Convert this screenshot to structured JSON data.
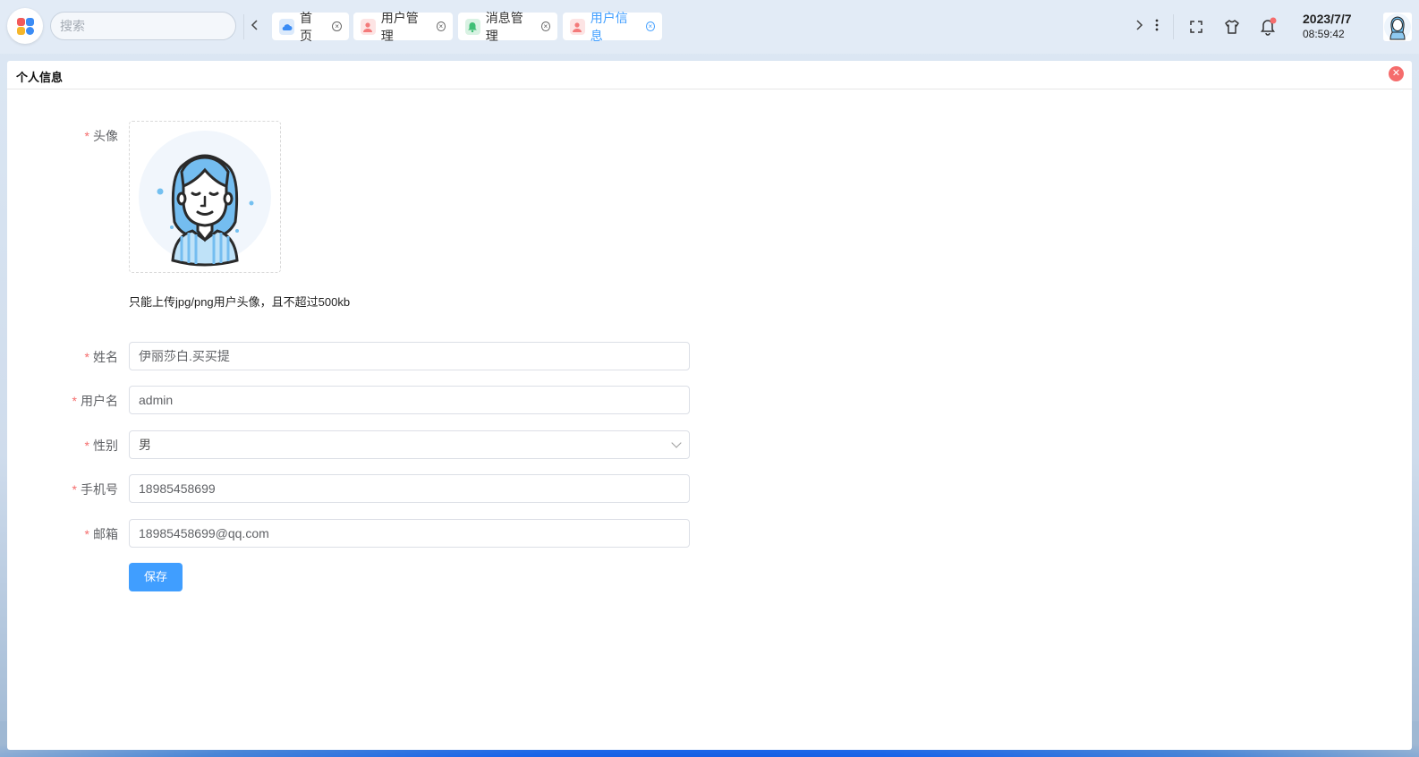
{
  "search": {
    "placeholder": "搜索"
  },
  "tabs": [
    {
      "label": "首页",
      "icon": "cloud-home-icon",
      "active": false
    },
    {
      "label": "用户管理",
      "icon": "user-icon",
      "active": false
    },
    {
      "label": "消息管理",
      "icon": "bell-icon",
      "active": false
    },
    {
      "label": "用户信息",
      "icon": "user-icon",
      "active": true
    }
  ],
  "clock": {
    "date": "2023/7/7",
    "time": "08:59:42"
  },
  "panel": {
    "title": "个人信息"
  },
  "form": {
    "avatar_label": "头像",
    "upload_hint": "只能上传jpg/png用户头像，且不超过500kb",
    "name_label": "姓名",
    "name_value": "伊丽莎白.买买提",
    "username_label": "用户名",
    "username_value": "admin",
    "gender_label": "性别",
    "gender_value": "男",
    "phone_label": "手机号",
    "phone_value": "18985458699",
    "email_label": "邮箱",
    "email_value": "18985458699@qq.com",
    "required_mark": "*",
    "save_label": "保存"
  },
  "colors": {
    "primary": "#409eff",
    "danger": "#f56c6c",
    "notification_dot": "#f56c6c"
  }
}
